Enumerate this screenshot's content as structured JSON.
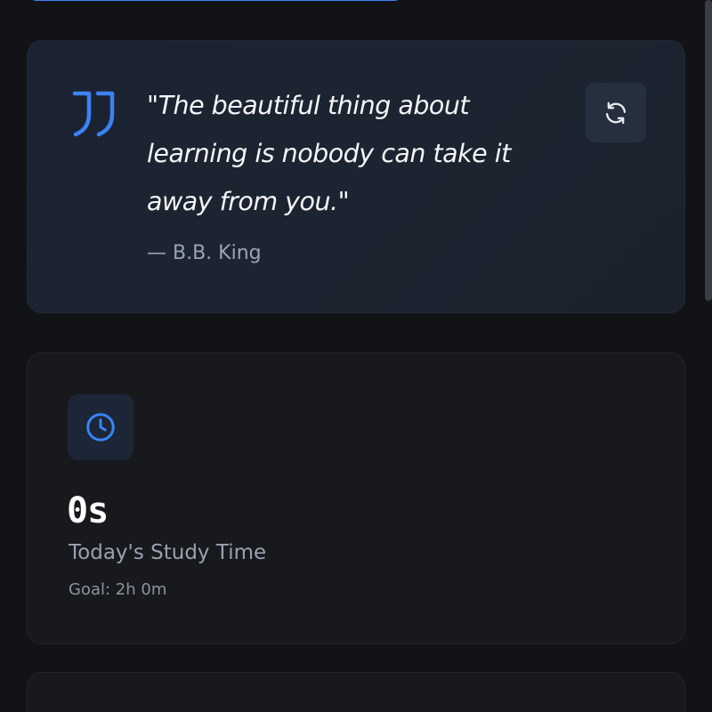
{
  "quote": {
    "text": "\"The beautiful thing about learning is nobody can take it away from you.\"",
    "author": "— B.B. King",
    "quote_icon": "quote-mark-icon",
    "refresh_icon": "refresh-icon"
  },
  "study": {
    "icon": "clock-icon",
    "value": "0s",
    "label": "Today's Study Time",
    "goal": "Goal: 2h 0m"
  },
  "colors": {
    "accent": "#3b82f6",
    "background": "#121316",
    "quote_card": "#1c2431",
    "stat_card": "#18191d",
    "muted_text": "#98a1b0"
  }
}
